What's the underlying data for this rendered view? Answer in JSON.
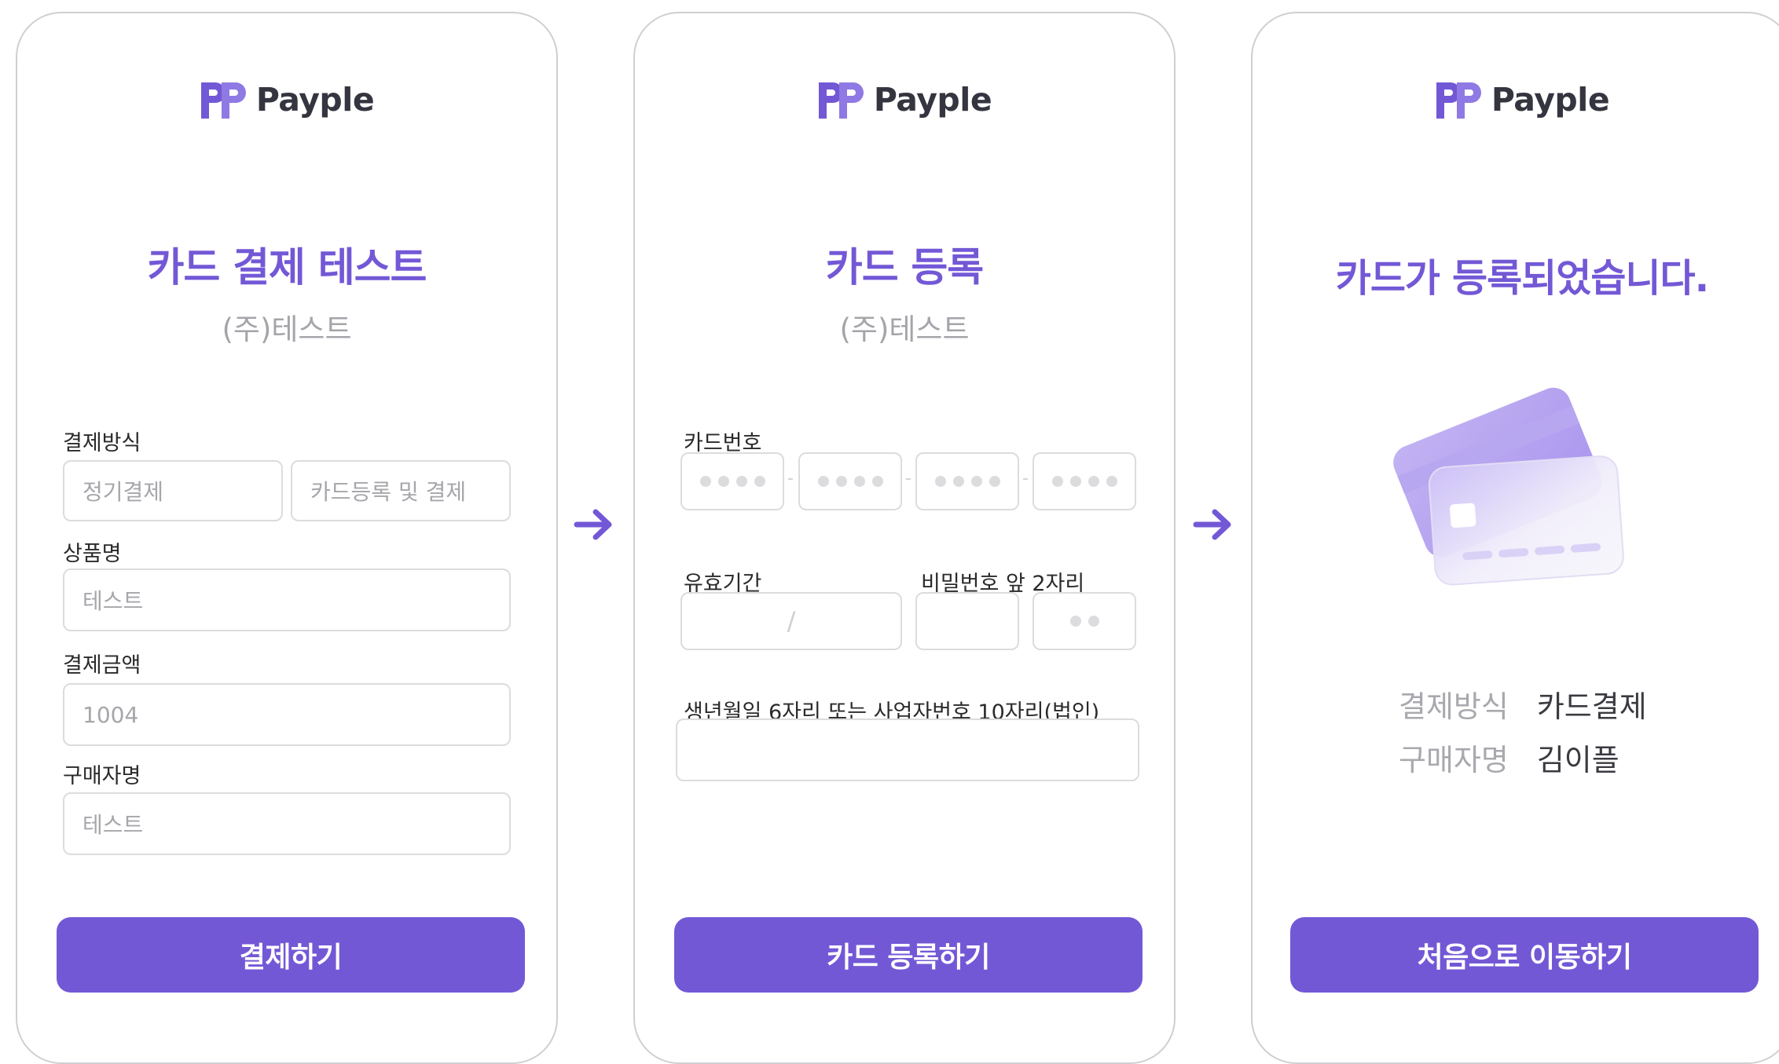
{
  "brand": {
    "name": "Payple",
    "color": "#7358d6"
  },
  "screens": {
    "payment": {
      "title": "카드 결제 테스트",
      "company": "(주)테스트",
      "method_label": "결제방식",
      "method_options": [
        "정기결제",
        "카드등록 및 결제"
      ],
      "product_label": "상품명",
      "product_value": "테스트",
      "amount_label": "결제금액",
      "amount_value": "1004",
      "buyer_label": "구매자명",
      "buyer_value": "테스트",
      "submit_label": "결제하기"
    },
    "register": {
      "title": "카드 등록",
      "company": "(주)테스트",
      "card_number_label": "카드번호",
      "card_number_separator": "-",
      "expiry_label": "유효기간",
      "expiry_separator": "/",
      "password_label": "비밀번호 앞 2자리",
      "birth_label": "생년월일 6자리 또는 사업자번호 10자리(법인)",
      "submit_label": "카드 등록하기"
    },
    "complete": {
      "title": "카드가 등록되었습니다.",
      "method_key": "결제방식",
      "method_value": "카드결제",
      "buyer_key": "구매자명",
      "buyer_value": "김이플",
      "submit_label": "처음으로 이동하기"
    }
  },
  "icons": [
    "payple-logo-icon",
    "arrow-right-icon",
    "credit-card-illustration-icon"
  ]
}
